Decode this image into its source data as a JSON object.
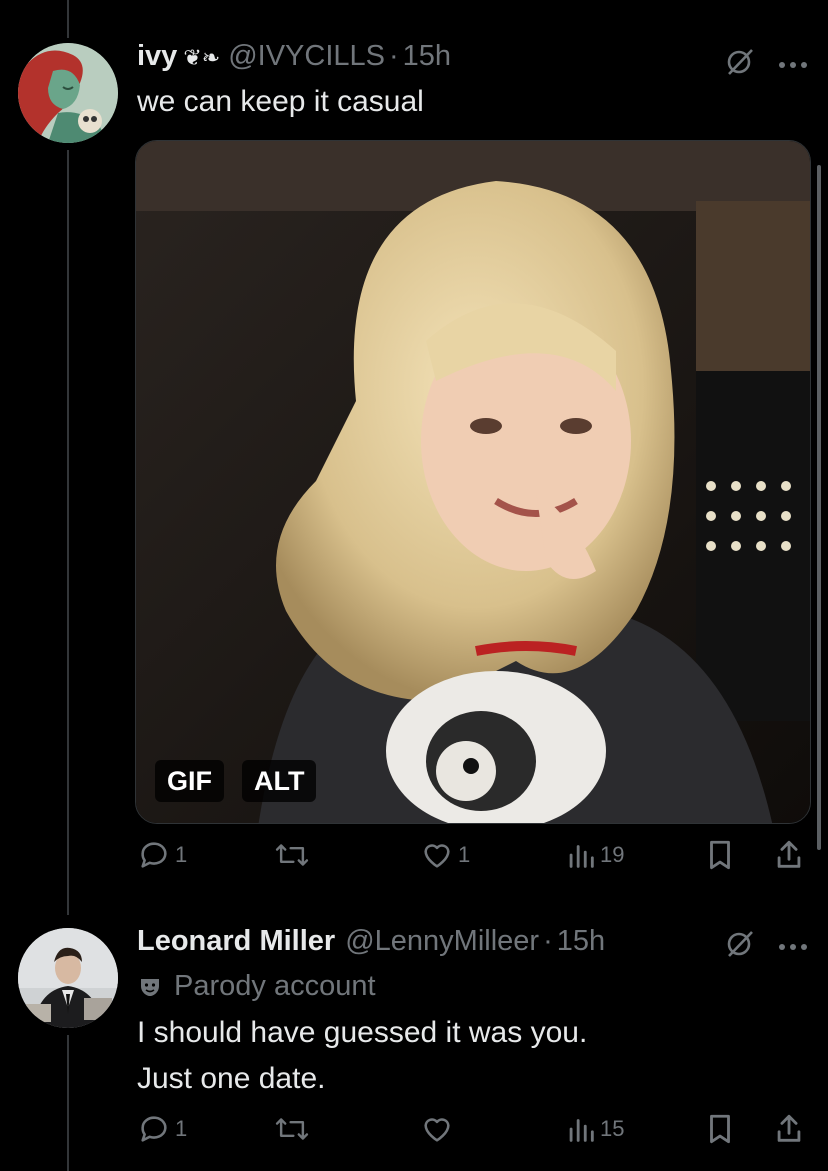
{
  "tweet1": {
    "name": "ivy",
    "emoji": "❦❧",
    "handle": "@IVYCILLS",
    "sep": "·",
    "time": "15h",
    "text": "we can keep it casual",
    "media": {
      "gif_label": "GIF",
      "alt_label": "ALT"
    },
    "actions": {
      "replies": "1",
      "reposts": "",
      "likes": "1",
      "views": "19"
    }
  },
  "tweet2": {
    "name": "Leonard Miller",
    "handle": "@LennyMilleer",
    "sep": "·",
    "time": "15h",
    "label": "Parody account",
    "text_line1": "I should have guessed it was you.",
    "text_line2": "Just one date.",
    "actions": {
      "replies": "1",
      "reposts": "",
      "likes": "",
      "views": "15"
    }
  },
  "colors": {
    "background": "#000000",
    "text": "#e7e9ea",
    "muted": "#71767b",
    "divider": "#333639"
  },
  "icons": [
    "grok-icon",
    "more-icon",
    "reply-icon",
    "repost-icon",
    "like-icon",
    "views-icon",
    "bookmark-icon",
    "share-icon",
    "parody-mask-icon"
  ]
}
